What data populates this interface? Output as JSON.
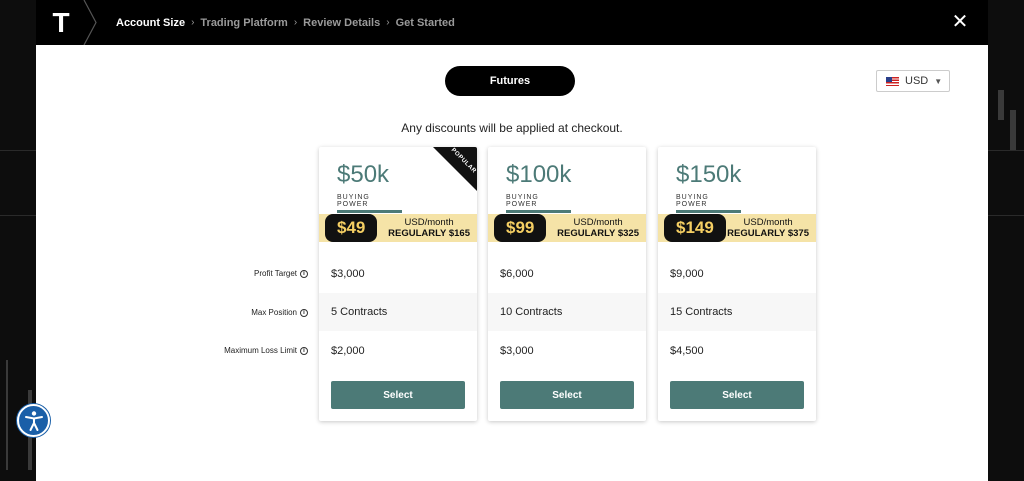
{
  "header": {
    "logo_letter": "T",
    "breadcrumbs": [
      "Account Size",
      "Trading Platform",
      "Review Details",
      "Get Started"
    ],
    "separator": "›",
    "close_symbol": "✕"
  },
  "tabs": {
    "futures_label": "Futures"
  },
  "currency": {
    "selected": "USD",
    "flag_icon": "us-flag-icon"
  },
  "discount_note": "Any discounts will be applied at checkout.",
  "row_labels": [
    "Profit Target",
    "Max Position",
    "Maximum Loss Limit"
  ],
  "colors": {
    "accent": "#4c7a77",
    "price_band": "#f5e3a7",
    "price_text": "#f5cf63",
    "accessibility": "#1a5fa8"
  },
  "plans": [
    {
      "amount": "$50k",
      "buying_power_label": "BUYING POWER",
      "price": "$49",
      "price_unit": "USD/month",
      "regular": "REGULARLY $165",
      "profit_target": "$3,000",
      "max_position": "5 Contracts",
      "max_loss": "$2,000",
      "select_label": "Select",
      "badge": "POPULAR"
    },
    {
      "amount": "$100k",
      "buying_power_label": "BUYING POWER",
      "price": "$99",
      "price_unit": "USD/month",
      "regular": "REGULARLY $325",
      "profit_target": "$6,000",
      "max_position": "10 Contracts",
      "max_loss": "$3,000",
      "select_label": "Select"
    },
    {
      "amount": "$150k",
      "buying_power_label": "BUYING POWER",
      "price": "$149",
      "price_unit": "USD/month",
      "regular": "REGULARLY $375",
      "profit_target": "$9,000",
      "max_position": "15 Contracts",
      "max_loss": "$4,500",
      "select_label": "Select"
    }
  ]
}
